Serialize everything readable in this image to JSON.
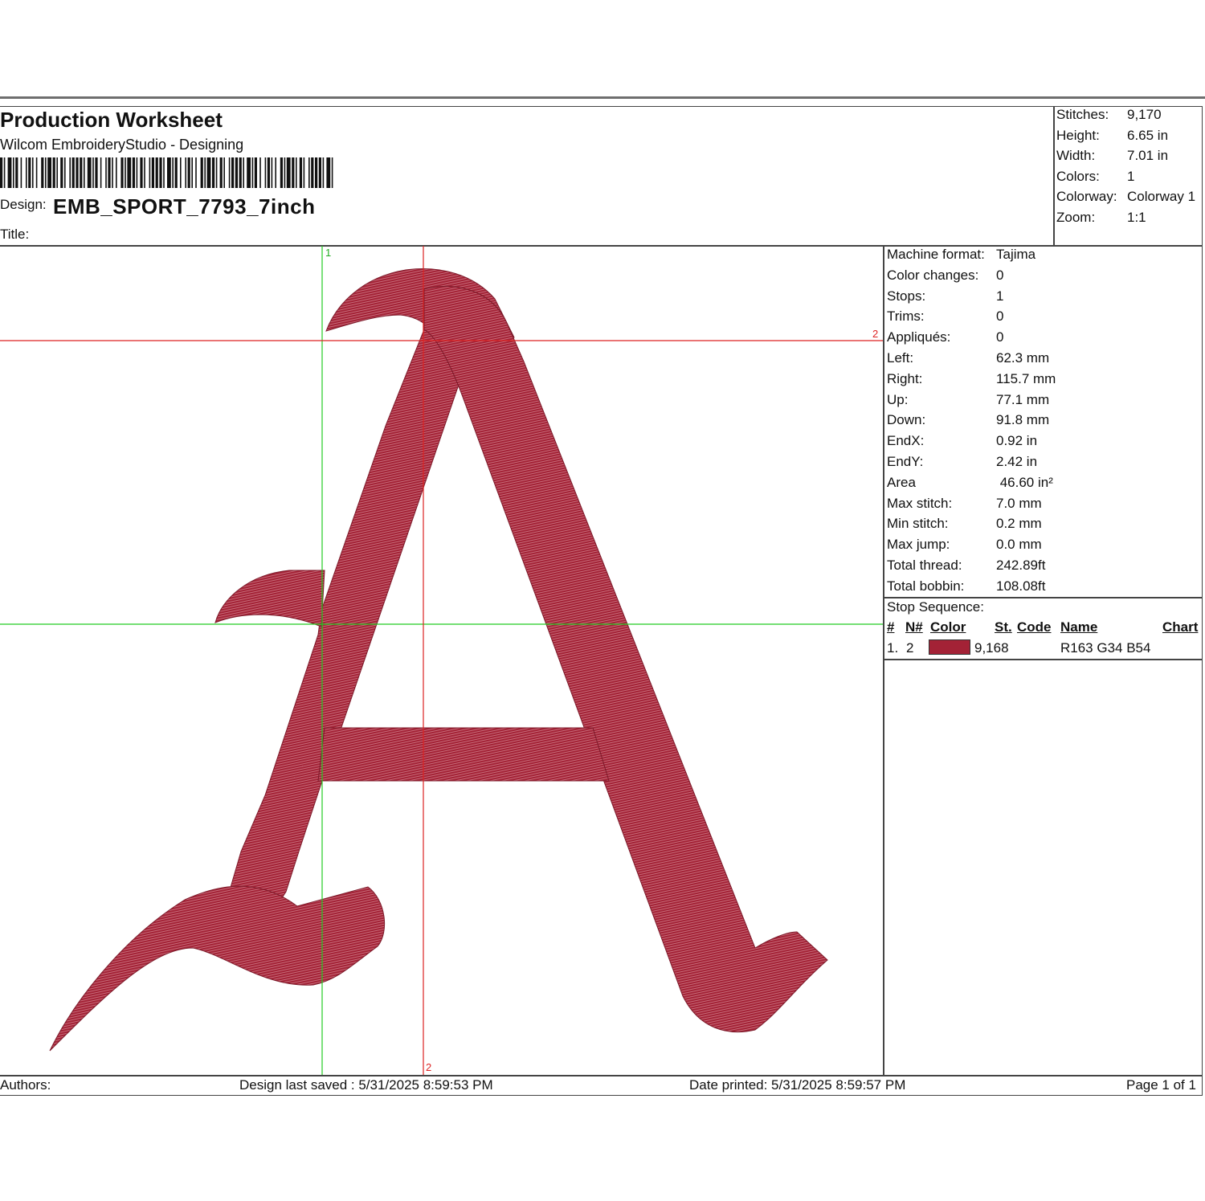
{
  "header": {
    "title": "Production Worksheet",
    "app_name": "Wilcom EmbroideryStudio - Designing",
    "design_label": "Design:",
    "design_name": "EMB_SPORT_7793_7inch",
    "title_label": "Title:"
  },
  "stats": [
    {
      "label": "Stitches:",
      "value": "9,170"
    },
    {
      "label": "Height:",
      "value": "6.65 in"
    },
    {
      "label": "Width:",
      "value": "7.01 in"
    },
    {
      "label": "Colors:",
      "value": "1"
    },
    {
      "label": "Colorway:",
      "value": "Colorway 1"
    },
    {
      "label": "Zoom:",
      "value": "1:1"
    }
  ],
  "machine_info": [
    {
      "label": "Machine format:",
      "value": "Tajima"
    },
    {
      "label": "Color changes:",
      "value": "0"
    },
    {
      "label": "Stops:",
      "value": "1"
    },
    {
      "label": "Trims:",
      "value": "0"
    },
    {
      "label": "Appliqués:",
      "value": "0"
    },
    {
      "label": "Left:",
      "value": "62.3 mm"
    },
    {
      "label": "Right:",
      "value": "115.7 mm"
    },
    {
      "label": "Up:",
      "value": "77.1 mm"
    },
    {
      "label": "Down:",
      "value": "91.8 mm"
    },
    {
      "label": "EndX:",
      "value": "0.92 in"
    },
    {
      "label": "EndY:",
      "value": "2.42 in"
    },
    {
      "label": "Area",
      "value": " 46.60 in²"
    },
    {
      "label": "Max stitch:",
      "value": "7.0 mm"
    },
    {
      "label": "Min stitch:",
      "value": "0.2 mm"
    },
    {
      "label": "Max jump:",
      "value": "0.0 mm"
    },
    {
      "label": "Total thread:",
      "value": "242.89ft"
    },
    {
      "label": "Total bobbin:",
      "value": "108.08ft"
    }
  ],
  "stop_sequence": {
    "label": "Stop Sequence:",
    "headers": {
      "num": "#",
      "needle": "N#",
      "color": "Color",
      "stitches": "St.",
      "code": "Code",
      "name": "Name",
      "chart": "Chart"
    },
    "rows": [
      {
        "num": "1.",
        "needle": "2",
        "color": "#a32236",
        "stitches": "9,168",
        "name": "R163 G34 B54"
      }
    ]
  },
  "crosshair_labels": {
    "green_top": "1",
    "red_right": "2",
    "red_bottom": "2"
  },
  "colors": {
    "thread": "#a32236",
    "guide_green": "#22cc22",
    "guide_red": "#dd2222"
  },
  "footer": {
    "authors": "Authors:",
    "last_saved": "Design last saved : 5/31/2025 8:59:53 PM",
    "printed": "Date printed: 5/31/2025 8:59:57 PM",
    "page": "Page 1 of 1"
  }
}
